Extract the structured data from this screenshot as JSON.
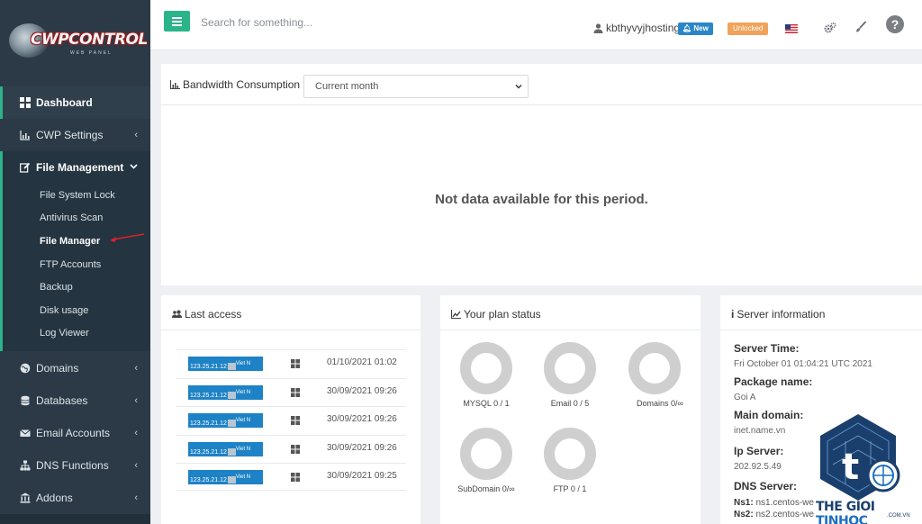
{
  "brand": {
    "logo_text": "CWPCONTROL",
    "logo_sub": "WEB PANEL"
  },
  "sidebar": {
    "items": [
      {
        "label": "Dashboard",
        "icon": "dashboard-icon"
      },
      {
        "label": "CWP Settings",
        "icon": "chart-icon"
      },
      {
        "label": "File Management",
        "icon": "edit-icon"
      },
      {
        "label": "Domains",
        "icon": "globe-icon"
      },
      {
        "label": "Databases",
        "icon": "database-icon"
      },
      {
        "label": "Email Accounts",
        "icon": "envelope-icon"
      },
      {
        "label": "DNS Functions",
        "icon": "sitemap-icon"
      },
      {
        "label": "Addons",
        "icon": "bank-icon"
      }
    ],
    "file_management_sub": [
      "File System Lock",
      "Antivirus Scan",
      "File Manager",
      "FTP Accounts",
      "Backup",
      "Disk usage",
      "Log Viewer"
    ]
  },
  "topbar": {
    "search_placeholder": "Search for something...",
    "username": "kbthyvyjhosting",
    "new_badge": "New",
    "unlocked_badge": "Unlocked",
    "help": "?"
  },
  "bandwidth": {
    "title": "Bandwidth Consumption",
    "period_selected": "Current month",
    "empty_message": "Not data available for this period."
  },
  "last_access": {
    "title": "Last access",
    "rows": [
      {
        "ip": "123.25.21.12",
        "country": "Viet N",
        "date": "01/10/2021 01:02"
      },
      {
        "ip": "123.25.21.12",
        "country": "Viet N",
        "date": "30/09/2021 09:26"
      },
      {
        "ip": "123.25.21.12",
        "country": "Viet N",
        "date": "30/09/2021 09:26"
      },
      {
        "ip": "123.25.21.12",
        "country": "Viet N",
        "date": "30/09/2021 09:26"
      },
      {
        "ip": "123.25.21.12",
        "country": "Viet N",
        "date": "30/09/2021 09:25"
      }
    ]
  },
  "plan_status": {
    "title": "Your plan status",
    "items": [
      "MYSQL 0 / 1",
      "Email 0 / 5",
      "Domains 0/∞",
      "SubDomain 0/∞",
      "FTP 0 / 1"
    ]
  },
  "server_info": {
    "title": "Server information",
    "server_time_label": "Server Time:",
    "server_time": "Fri October 01 01:04:21 UTC 2021",
    "package_label": "Package name:",
    "package": "Goi A",
    "main_domain_label": "Main domain:",
    "main_domain": "inet.name.vn",
    "ip_label": "Ip Server:",
    "ip": "202.92.5.49",
    "dns_label": "DNS Server:",
    "ns1_label": "Ns1:",
    "ns1": "ns1.centos-we",
    "ns2_label": "Ns2:",
    "ns2": "ns2.centos-we"
  },
  "watermark": {
    "part1": "THE GIOI ",
    "part2": "TINHOC",
    "sub": ".COM.VN"
  },
  "colors": {
    "sidebar": "#2b3a46",
    "accent": "#2bb38a",
    "badge_new": "#2a86c8",
    "badge_unlocked": "#f0a35a",
    "ip_badge": "#1e82c6"
  }
}
